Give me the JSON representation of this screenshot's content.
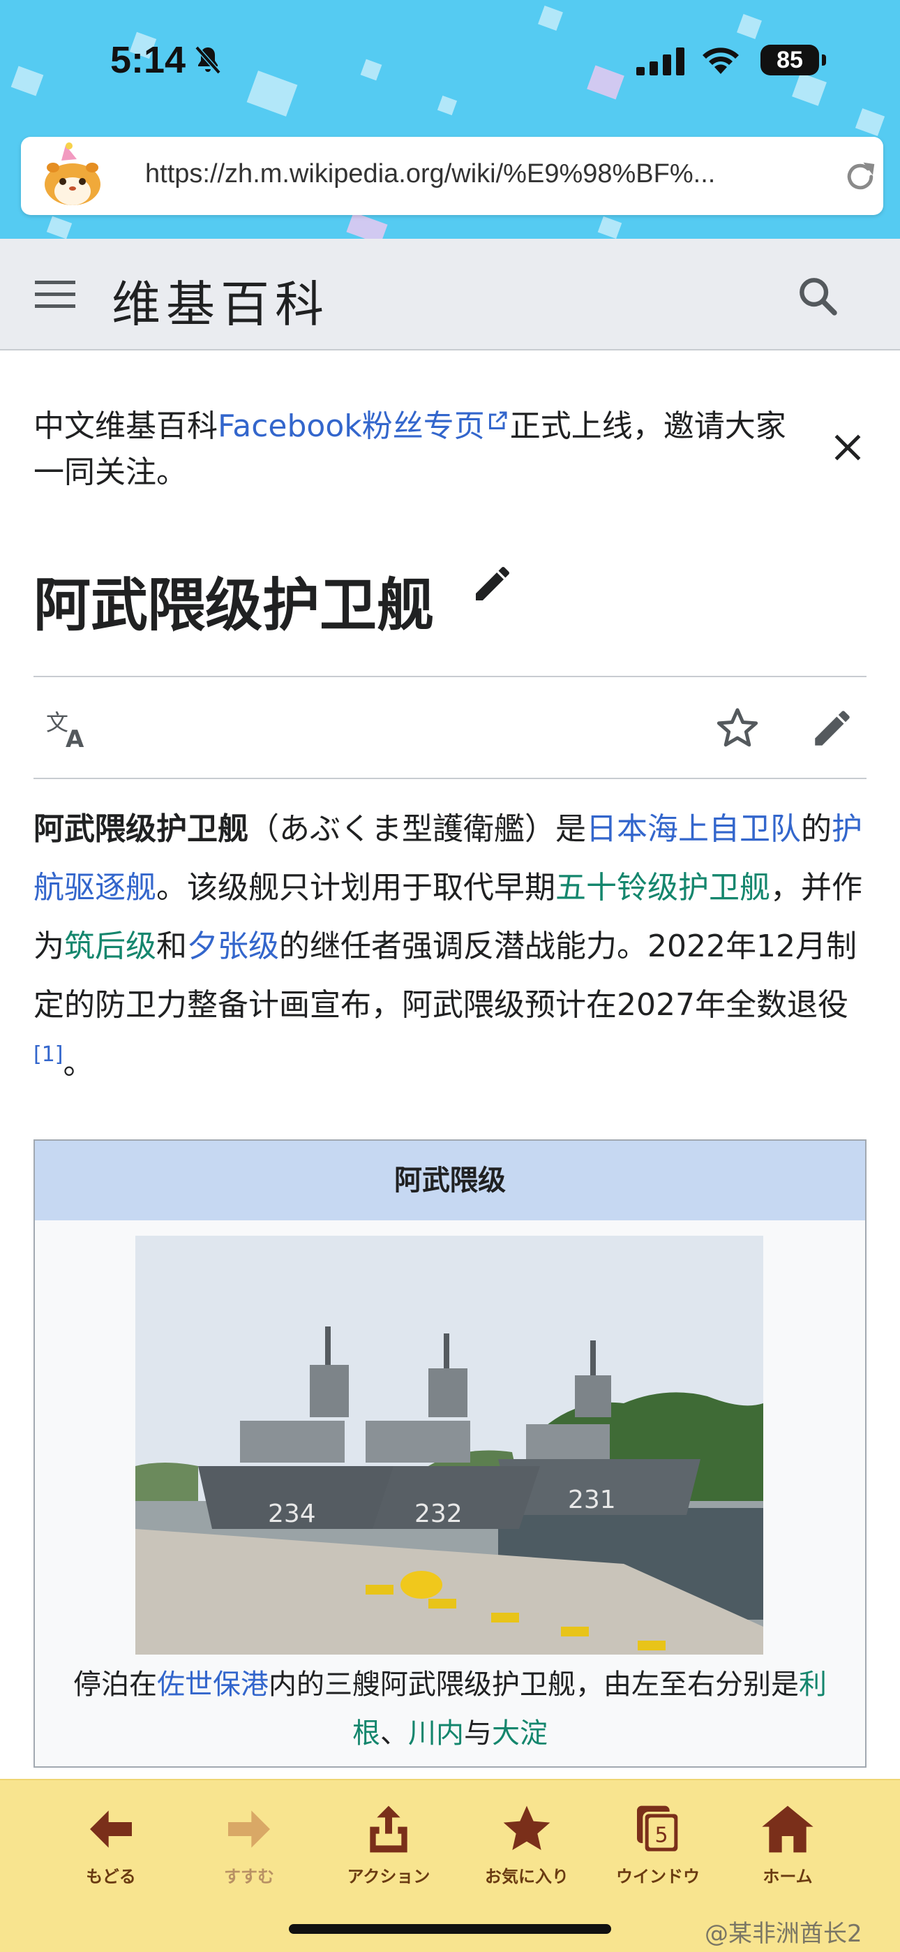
{
  "status_bar": {
    "time": "5:14",
    "battery": "85"
  },
  "browser": {
    "url": "https://zh.m.wikipedia.org/wiki/%E9%98%BF%E6%AD%A6%E9%9A%88%E7%BA%A7%E6%8A%A4%E5%8D%AB%E8%88%B0",
    "url_display": "https://zh.m.wikipedia.org/wiki/%E9%98%BF%..."
  },
  "wiki_header": {
    "wordmark": "维基百科"
  },
  "site_notice": {
    "text_before": "中文维基百科",
    "link": "Facebook粉丝专页",
    "text_after": "正式上线，邀请大家一同关注。"
  },
  "page": {
    "title": "阿武隈级护卫舰",
    "lead": {
      "bold": "阿武隈级护卫舰",
      "t1": "（あぶくま型護衛艦）是",
      "l1": "日本海上自卫队",
      "t2": "的",
      "l2": "护航驱逐舰",
      "t3": "。该级舰只计划用于取代早期",
      "l3": "五十铃级护卫舰",
      "t4": "，并作为",
      "l4": "筑后级",
      "t5": "和",
      "l5": "夕张级",
      "t6": "的继任者强调反潜战能力。2022年12月制定的防卫力整备计画宣布，阿武隈级预计在2027年全数退役",
      "ref": "[1]",
      "t7": "。"
    }
  },
  "infobox": {
    "header": "阿武隈级",
    "caption": {
      "t1": "停泊在",
      "l1": "佐世保港",
      "t2": "内的三艘阿武隈级护卫舰，由左至右分别是",
      "l2": "利根",
      "t3": "、",
      "l3": "川内",
      "t4": "与",
      "l4": "大淀"
    },
    "hull_numbers": [
      "234",
      "232",
      "231"
    ]
  },
  "toolbar": {
    "items": [
      {
        "label": "もどる",
        "icon": "back-arrow-icon"
      },
      {
        "label": "すすむ",
        "icon": "forward-arrow-icon"
      },
      {
        "label": "アクション",
        "icon": "share-icon"
      },
      {
        "label": "お気に入り",
        "icon": "star-icon"
      },
      {
        "label": "ウインドウ",
        "icon": "windows-icon",
        "count": "5"
      },
      {
        "label": "ホーム",
        "icon": "home-icon"
      }
    ]
  },
  "watermark": "@某非洲酋长2",
  "colors": {
    "sky": "#55cbf2",
    "link_blue": "#3366cc",
    "link_green": "#14866d",
    "toolbar_bg": "#f8e48f",
    "toolbar_text": "#6a3b12",
    "infobox_header": "#c6d8f2"
  }
}
